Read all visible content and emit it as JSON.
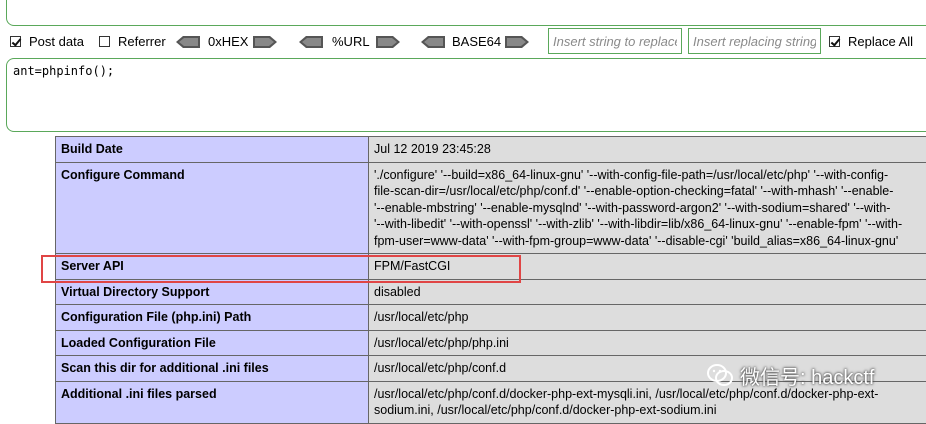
{
  "toolbar": {
    "post_data": {
      "label": "Post data",
      "checked": true
    },
    "referrer": {
      "label": "Referrer",
      "checked": false
    },
    "hex_label": "0xHEX",
    "url_label": "%URL",
    "base64_label": "BASE64",
    "insert_placeholder": "Insert string to replace",
    "replacing_placeholder": "Insert replacing string",
    "replace_all": {
      "label": "Replace All",
      "checked": true
    }
  },
  "post_body": "ant=phpinfo();",
  "rows": [
    {
      "name": "Build Date",
      "value": [
        "Jul 12 2019 23:45:28"
      ]
    },
    {
      "name": "Configure Command",
      "value": [
        "'./configure' '--build=x86_64-linux-gnu' '--with-config-file-path=/usr/local/etc/php' '--with-config-",
        "file-scan-dir=/usr/local/etc/php/conf.d' '--enable-option-checking=fatal' '--with-mhash' '--enable-",
        "'--enable-mbstring' '--enable-mysqlnd' '--with-password-argon2' '--with-sodium=shared' '--with-",
        "'--with-libedit' '--with-openssl' '--with-zlib' '--with-libdir=lib/x86_64-linux-gnu' '--enable-fpm' '--with-",
        "fpm-user=www-data' '--with-fpm-group=www-data' '--disable-cgi' 'build_alias=x86_64-linux-gnu'"
      ]
    },
    {
      "name": "Server API",
      "value": [
        "FPM/FastCGI"
      ]
    },
    {
      "name": "Virtual Directory Support",
      "value": [
        "disabled"
      ]
    },
    {
      "name": "Configuration File (php.ini) Path",
      "value": [
        "/usr/local/etc/php"
      ]
    },
    {
      "name": "Loaded Configuration File",
      "value": [
        "/usr/local/etc/php/php.ini"
      ]
    },
    {
      "name": "Scan this dir for additional .ini files",
      "value": [
        "/usr/local/etc/php/conf.d"
      ]
    },
    {
      "name": "Additional .ini files parsed",
      "value": [
        "/usr/local/etc/php/conf.d/docker-php-ext-mysqli.ini, /usr/local/etc/php/conf.d/docker-php-ext-",
        "sodium.ini, /usr/local/etc/php/conf.d/docker-php-ext-sodium.ini"
      ]
    }
  ],
  "watermark": "微信号: hackctf",
  "colors": {
    "accent_green": "#5aa85a",
    "highlight_red": "#e04545",
    "name_cell": "#ccccff",
    "value_cell": "#dddddd"
  }
}
